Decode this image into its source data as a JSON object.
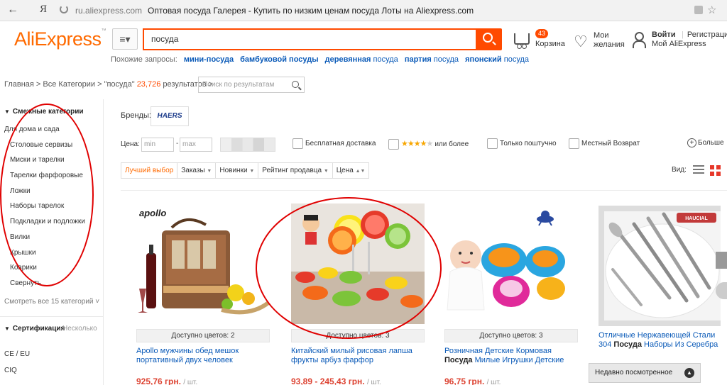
{
  "browser": {
    "back_icon": "arrow-left-icon",
    "brand_letter": "Я",
    "url": "ru.aliexpress.com",
    "page_title": "Оптовая посуда Галерея - Купить по низким ценам посуда Лоты на Aliexpress.com"
  },
  "header": {
    "logo": "AliExpress",
    "logo_mark": "™",
    "menu_label": "≡▾",
    "search_value": "посуда",
    "cart_count": "43",
    "cart_label": "Корзина",
    "wish_label": "Мои желания",
    "login_label": "Войти",
    "register_label": "Регистрация",
    "my_aliexpress": "Мой AliExpress"
  },
  "related": {
    "label": "Похожие запросы:",
    "queries": [
      {
        "bold": "мини-посуда",
        "rest": ""
      },
      {
        "bold": "бамбуковой посуды",
        "rest": ""
      },
      {
        "bold": "деревянная",
        "rest": " посуда"
      },
      {
        "bold": "партия",
        "rest": " посуда"
      },
      {
        "bold": "японский",
        "rest": " посуда"
      }
    ]
  },
  "breadcrumb": {
    "path": "Главная > Все Категории > \"посуда\"",
    "count": "23,726",
    "suffix": "результатов >",
    "search_placeholder": "Поиск по результатам"
  },
  "sidebar": {
    "title": "Смежные категории",
    "items": [
      "Для дома и сада",
      "Столовые сервизы",
      "Миски и тарелки",
      "Тарелки фарфоровые",
      "Ложки",
      "Наборы тарелок",
      "Подкладки и подложки",
      "Вилки",
      "Крышки",
      "Коврики",
      "Свернуть"
    ],
    "more": "Смотреть все 15 категорий",
    "cert_title": "Сертификация",
    "cert_meta": "Несколько",
    "cert_items": [
      "CE / EU",
      "CIQ"
    ]
  },
  "filters": {
    "brands_label": "Бренды:",
    "brand_name": "HAERS",
    "price_label": "Цена:",
    "price_min_placeholder": "min",
    "price_max_placeholder": "max",
    "price_dash": "-",
    "free_shipping": "Бесплатная доставка",
    "rating_stars": "★★★★",
    "rating_off_star": "★",
    "rating_label": "или более",
    "piece_only": "Только поштучно",
    "local_return": "Местный Возврат",
    "more_label": "Больше",
    "sort": [
      "Лучший выбор",
      "Заказы",
      "Новинки",
      "Рейтинг продавца",
      "Цена"
    ],
    "view_label": "Вид:"
  },
  "products": [
    {
      "colors": "Доступно цветов: 2",
      "title_parts": [
        "Apollo мужчины обед мешок портативный двух человек",
        "",
        ""
      ],
      "price": "925,76 грн.",
      "unit": "/ шт."
    },
    {
      "colors": "Доступно цветов: 3",
      "title_parts": [
        "Китайский милый рисовая лапша фрукты арбуз фарфор",
        "",
        ""
      ],
      "price": "93,89 - 245,43 грн.",
      "unit": "/ шт."
    },
    {
      "colors": "Доступно цветов: 3",
      "title_parts": [
        "Розничная Детские Кормовая ",
        "Посуда",
        " Милые Игрушки Детские"
      ],
      "price": "96,75 грн.",
      "unit": "/ шт."
    },
    {
      "colors": "",
      "title_parts": [
        "Отличные Нержавеющей Стали 304 ",
        "Посуда",
        " Наборы Из Серебра"
      ],
      "price": "",
      "unit": ""
    }
  ],
  "product_logos": {
    "apollo": "apollo",
    "haucial": "HAUCIAL"
  },
  "recent_label": "Недавно посмотренное",
  "colors": {
    "accent": "#ff4a00",
    "link": "#0a5ab8",
    "annotation": "#e00000"
  }
}
